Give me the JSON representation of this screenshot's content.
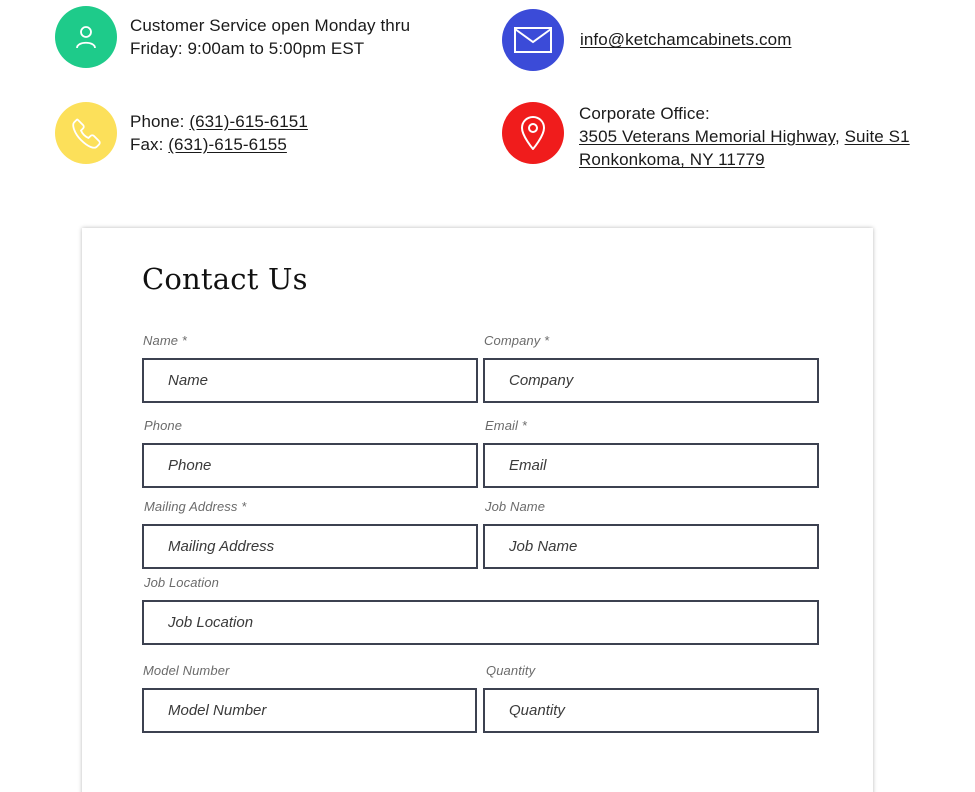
{
  "contact_info": {
    "hours": {
      "icon": "person-icon",
      "color": "#1ECB8A",
      "line1": "Customer Service open Monday thru",
      "line2": "Friday: 9:00am to 5:00pm EST"
    },
    "email": {
      "icon": "envelope-icon",
      "color": "#3B4BD8",
      "address": "info@ketchamcabinets.com"
    },
    "phone": {
      "icon": "phone-icon",
      "color": "#FCE05A",
      "phone_label": "Phone: ",
      "phone_number": "(631)-615-6151",
      "fax_label": "Fax: ",
      "fax_number": "(631)-615-6155"
    },
    "office": {
      "icon": "location-pin-icon",
      "color": "#F01C1C",
      "title": "Corporate Office:",
      "street": "3505 Veterans Memorial Highway",
      "separator": ", ",
      "suite": "Suite S1",
      "city": "Ronkonkoma, NY 11779"
    }
  },
  "form": {
    "title": "Contact Us",
    "fields": {
      "name": {
        "label": "Name *",
        "placeholder": "Name"
      },
      "company": {
        "label": "Company *",
        "placeholder": "Company"
      },
      "phone": {
        "label": "Phone",
        "placeholder": "Phone"
      },
      "email": {
        "label": "Email *",
        "placeholder": "Email"
      },
      "mailing_address": {
        "label": "Mailing Address *",
        "placeholder": "Mailing Address"
      },
      "job_name": {
        "label": "Job Name",
        "placeholder": "Job Name"
      },
      "job_location": {
        "label": "Job Location",
        "placeholder": "Job Location"
      },
      "model_number": {
        "label": "Model Number",
        "placeholder": "Model Number"
      },
      "quantity": {
        "label": "Quantity",
        "placeholder": "Quantity"
      }
    },
    "border_color": "#3C4150"
  }
}
